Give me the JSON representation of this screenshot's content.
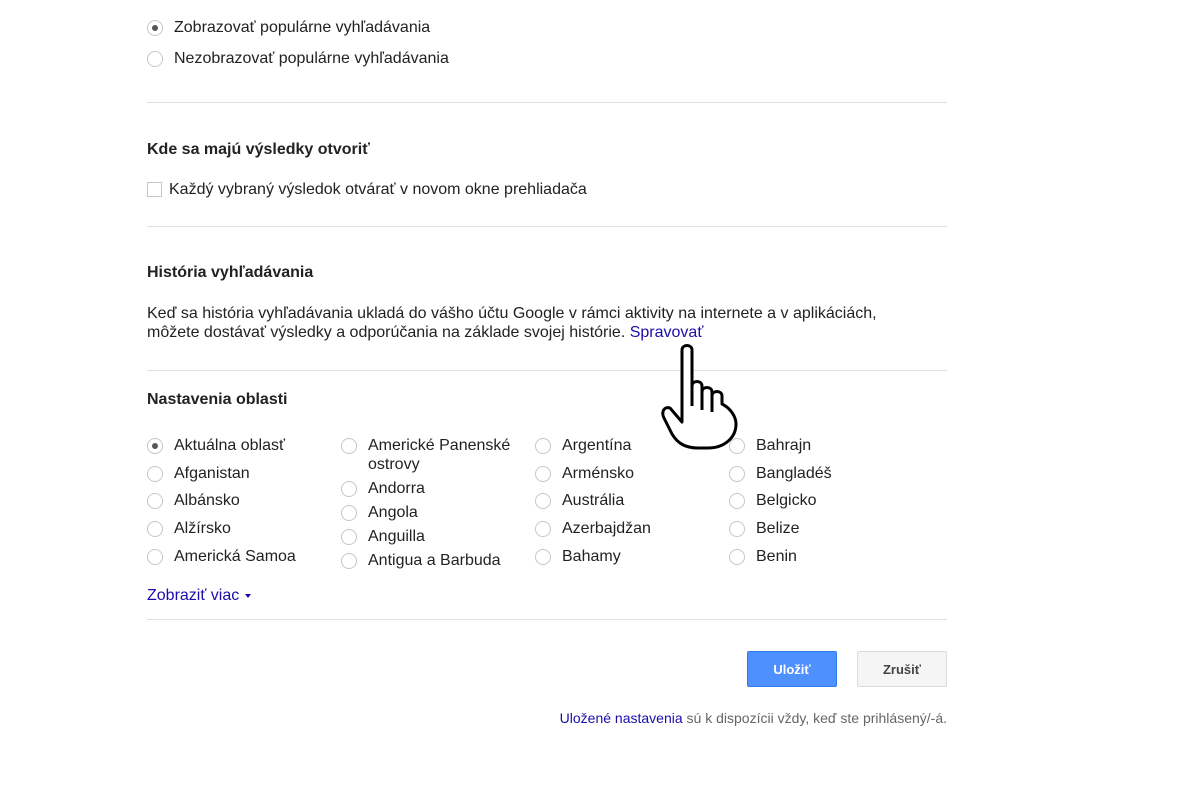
{
  "popular_searches": {
    "options": [
      {
        "label": "Zobrazovať populárne vyhľadávania",
        "checked": true
      },
      {
        "label": "Nezobrazovať populárne vyhľadávania",
        "checked": false
      }
    ]
  },
  "results_open": {
    "heading": "Kde sa majú výsledky otvoriť",
    "checkbox_label": "Každý vybraný výsledok otvárať v novom okne prehliadača",
    "checked": false
  },
  "search_history": {
    "heading": "História vyhľadávania",
    "text_line1": "Keď sa história vyhľadávania ukladá do vášho účtu Google v rámci aktivity na internete a v aplikáciách,",
    "text_line2": "môžete dostávať výsledky a odporúčania na základe svojej histórie.",
    "manage_link": "Spravovať"
  },
  "region_settings": {
    "heading": "Nastavenia oblasti",
    "columns": [
      [
        {
          "label": "Aktuálna oblasť",
          "checked": true
        },
        {
          "label": "Afganistan",
          "checked": false
        },
        {
          "label": "Albánsko",
          "checked": false
        },
        {
          "label": "Alžírsko",
          "checked": false
        },
        {
          "label": "Americká Samoa",
          "checked": false
        }
      ],
      [
        {
          "label": "Americké Panenské ostrovy",
          "checked": false
        },
        {
          "label": "Andorra",
          "checked": false
        },
        {
          "label": "Angola",
          "checked": false
        },
        {
          "label": "Anguilla",
          "checked": false
        },
        {
          "label": "Antigua a Barbuda",
          "checked": false
        }
      ],
      [
        {
          "label": "Argentína",
          "checked": false
        },
        {
          "label": "Arménsko",
          "checked": false
        },
        {
          "label": "Austrália",
          "checked": false
        },
        {
          "label": "Azerbajdžan",
          "checked": false
        },
        {
          "label": "Bahamy",
          "checked": false
        }
      ],
      [
        {
          "label": "Bahrajn",
          "checked": false
        },
        {
          "label": "Bangladéš",
          "checked": false
        },
        {
          "label": "Belgicko",
          "checked": false
        },
        {
          "label": "Belize",
          "checked": false
        },
        {
          "label": "Benin",
          "checked": false
        }
      ]
    ],
    "show_more": "Zobraziť viac"
  },
  "buttons": {
    "save": "Uložiť",
    "cancel": "Zrušiť"
  },
  "footer": {
    "link": "Uložené nastavenia",
    "text": " sú k dispozícii vždy, keď ste prihlásený/-á."
  },
  "colors": {
    "link": "#1a0dab",
    "save_button": "#4d90fe",
    "divider": "#e0e0e0"
  },
  "icons": [
    "hand-pointer-cursor-icon",
    "caret-down-icon"
  ]
}
